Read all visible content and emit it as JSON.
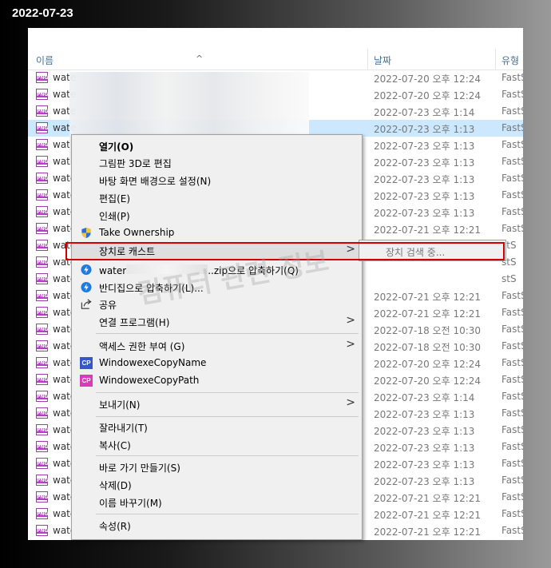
{
  "top_date": "2022-07-23",
  "header": {
    "name": "이름",
    "date": "날짜",
    "type": "유형"
  },
  "rows": [
    {
      "name": "wate",
      "date": "2022-07-20 오후 12:24",
      "type": "FastS"
    },
    {
      "name": "wate",
      "date": "2022-07-20 오후 12:24",
      "type": "FastS"
    },
    {
      "name": "wate",
      "date": "2022-07-23 오후 1:14",
      "type": "FastS"
    },
    {
      "name": "wate",
      "date": "2022-07-23 오후 1:13",
      "type": "FastS"
    },
    {
      "name": "wate",
      "date": "2022-07-23 오후 1:13",
      "type": "FastS"
    },
    {
      "name": "wate",
      "date": "2022-07-23 오후 1:13",
      "type": "FastS"
    },
    {
      "name": "wate",
      "date": "2022-07-23 오후 1:13",
      "type": "FastS"
    },
    {
      "name": "wate",
      "date": "2022-07-23 오후 1:13",
      "type": "FastS"
    },
    {
      "name": "wate",
      "date": "2022-07-23 오후 1:13",
      "type": "FastS"
    },
    {
      "name": "wate",
      "date": "2022-07-21 오후 12:21",
      "type": "FastS"
    },
    {
      "name": "wate",
      "date": "",
      "type": "stS"
    },
    {
      "name": "wate",
      "date": "",
      "type": "stS"
    },
    {
      "name": "wate",
      "date": "",
      "type": "stS"
    },
    {
      "name": "wate",
      "date": "2022-07-21 오후 12:21",
      "type": "FastS"
    },
    {
      "name": "wate",
      "date": "2022-07-21 오후 12:21",
      "type": "FastS"
    },
    {
      "name": "wate",
      "date": "2022-07-18 오전 10:30",
      "type": "FastS"
    },
    {
      "name": "wate",
      "date": "2022-07-18 오전 10:30",
      "type": "FastS"
    },
    {
      "name": "wate",
      "date": "2022-07-20 오후 12:24",
      "type": "FastS"
    },
    {
      "name": "wate",
      "date": "2022-07-20 오후 12:24",
      "type": "FastS"
    },
    {
      "name": "wate",
      "date": "2022-07-23 오후 1:14",
      "type": "FastS"
    },
    {
      "name": "wate",
      "date": "2022-07-23 오후 1:13",
      "type": "FastS"
    },
    {
      "name": "wate",
      "date": "2022-07-23 오후 1:13",
      "type": "FastS"
    },
    {
      "name": "wate",
      "date": "2022-07-23 오후 1:13",
      "type": "FastS"
    },
    {
      "name": "wate",
      "date": "2022-07-23 오후 1:13",
      "type": "FastS"
    },
    {
      "name": "wate",
      "date": "2022-07-23 오후 1:13",
      "type": "FastS"
    },
    {
      "name": "wate",
      "date": "2022-07-21 오후 12:21",
      "type": "FastS"
    },
    {
      "name": "wate",
      "date": "2022-07-21 오후 12:21",
      "type": "FastS"
    },
    {
      "name": "wate",
      "date": "2022-07-21 오후 12:21",
      "type": "FastS"
    }
  ],
  "file_icon_text": "PNG",
  "context_menu": {
    "open": "열기(O)",
    "paint3d": "그림판 3D로 편집",
    "set_bg": "바탕 화면 배경으로 설정(N)",
    "edit": "편집(E)",
    "print": "인쇄(P)",
    "take_ownership": "Take Ownership",
    "cast": "장치로 캐스트",
    "zip_prefix": "water",
    "zip_suffix": "..zip으로 압축하기(Q)",
    "bandizip": "반디집으로 압축하기(L)...",
    "share": "공유",
    "open_with": "연결 프로그램(H)",
    "grant_access": "액세스 권한 부여 (G)",
    "copy_name": "WindowexeCopyName",
    "copy_path": "WindowexeCopyPath",
    "cp_badge": "CP",
    "send_to": "보내기(N)",
    "cut": "잘라내기(T)",
    "copy": "복사(C)",
    "create_shortcut": "바로 가기 만들기(S)",
    "delete": "삭제(D)",
    "rename": "이름 바꾸기(M)",
    "properties": "속성(R)"
  },
  "submenu": {
    "searching": "장치 검색 중..."
  },
  "watermark": "컴퓨터 관련 정보",
  "colors": {
    "highlight_box": "#d40000",
    "selection": "#cce8ff",
    "png_icon": "#b53cc6",
    "cp_name": "#3557c9",
    "cp_path": "#d63cb9"
  }
}
